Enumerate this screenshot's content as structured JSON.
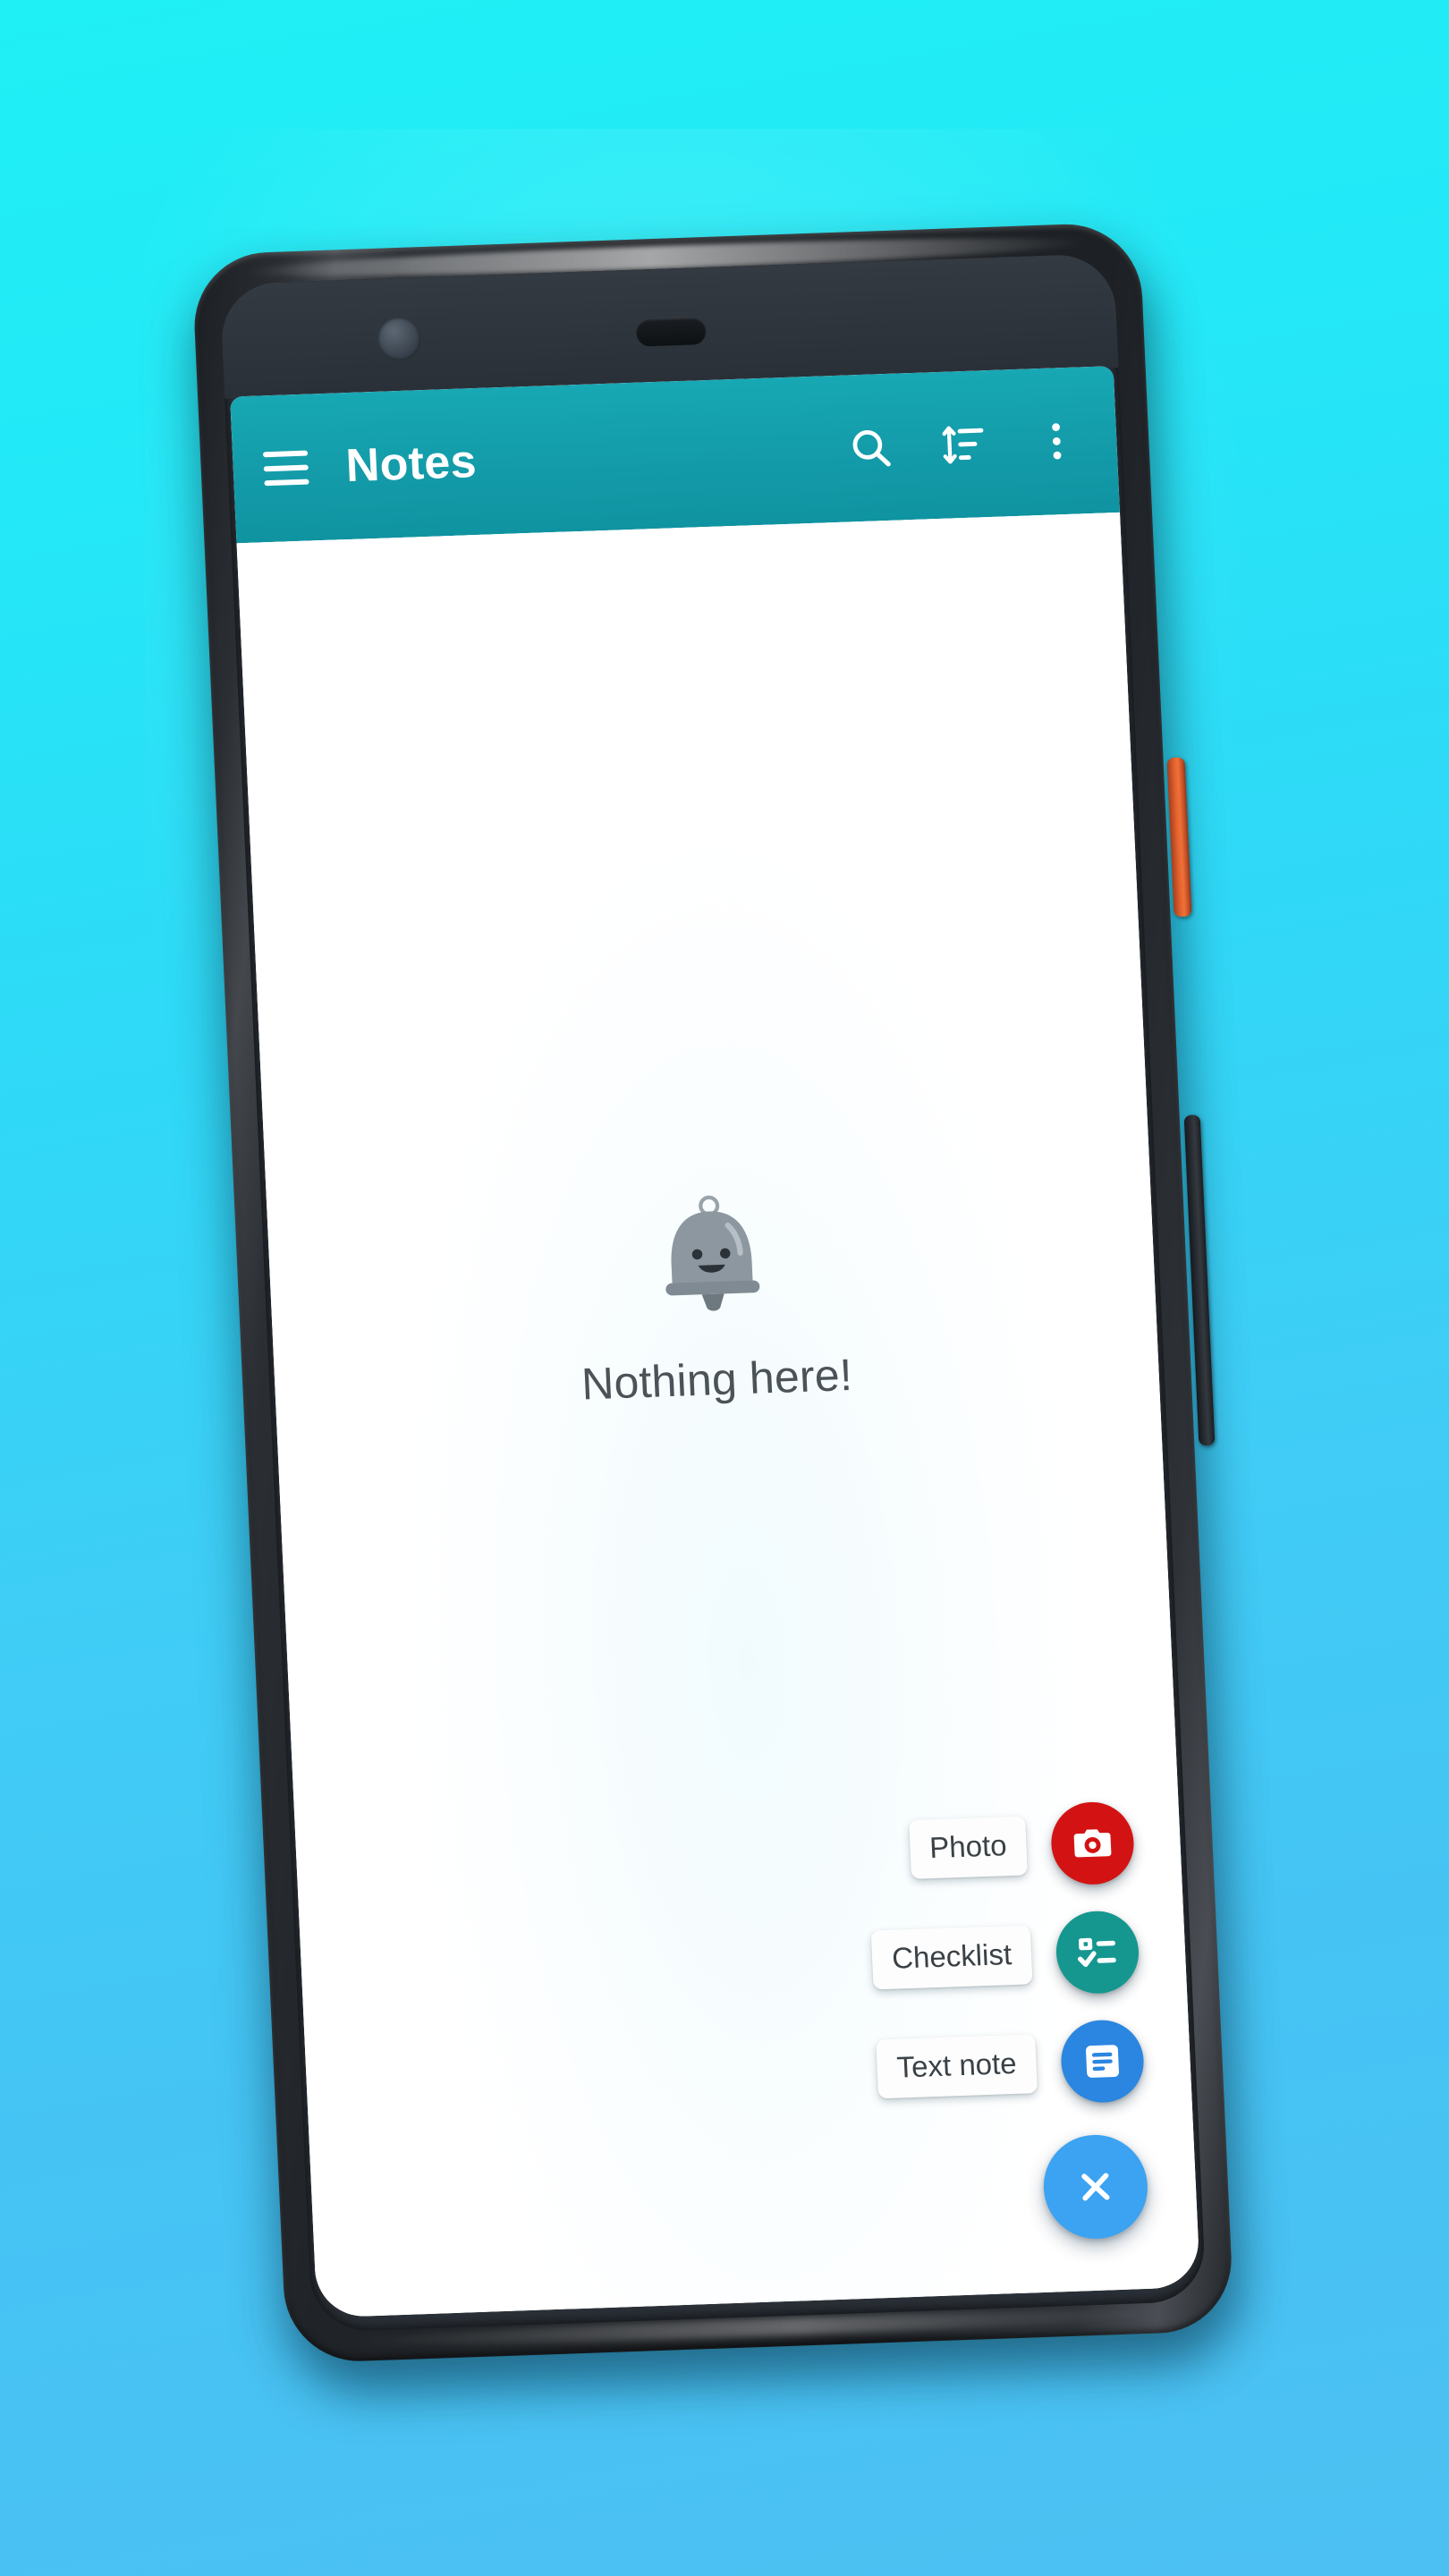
{
  "background": {
    "gradient_top": "#1ff0f5",
    "gradient_bottom": "#4cc0f2"
  },
  "device": {
    "frame_color": "#22262a",
    "bezel_color": "#2b3138",
    "power_button_color": "#e4642e",
    "volume_button_color": "#2c3137",
    "front_camera_name": "front-camera",
    "earpiece_name": "earpiece-speaker"
  },
  "app": {
    "title": "Notes",
    "appbar_color": "#139aa8",
    "nav_icon": "hamburger-menu-icon",
    "actions": [
      {
        "name": "search-icon",
        "label": "Search"
      },
      {
        "name": "sort-icon",
        "label": "Sort"
      },
      {
        "name": "overflow-menu-icon",
        "label": "More options"
      }
    ]
  },
  "empty_state": {
    "icon": "bell-smiling-icon",
    "icon_color": "#8a949c",
    "message": "Nothing here!",
    "message_color": "#4b5358"
  },
  "fab_menu": {
    "expanded": true,
    "items": [
      {
        "label": "Photo",
        "icon": "camera-icon",
        "color": "#d31313"
      },
      {
        "label": "Checklist",
        "icon": "checklist-icon",
        "color": "#159790"
      },
      {
        "label": "Text note",
        "icon": "text-note-icon",
        "color": "#2a86e0"
      }
    ],
    "main": {
      "label": "Close",
      "icon": "close-x-icon",
      "color": "#3ba3f2"
    }
  }
}
